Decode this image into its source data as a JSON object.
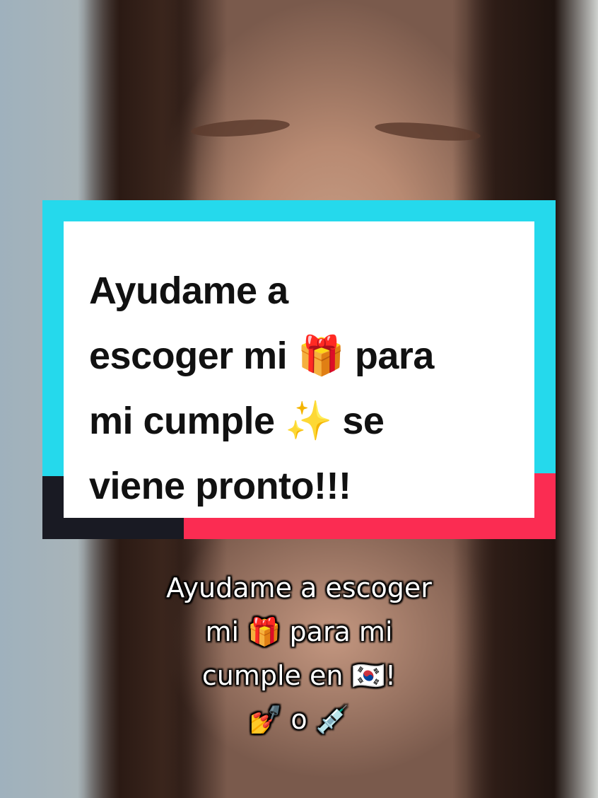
{
  "title_card": {
    "lines": [
      "Ayudame a",
      "escoger mi 🎁 para",
      "mi cumple ✨ se",
      "viene pronto!!!"
    ]
  },
  "caption": {
    "lines": [
      "Ayudame a escoger",
      "mi 🎁 para mi",
      "cumple en 🇰🇷!",
      "💅 o 💉"
    ]
  },
  "colors": {
    "cyan": "#25d9ec",
    "red": "#fb2c52",
    "dark": "#191a23"
  }
}
